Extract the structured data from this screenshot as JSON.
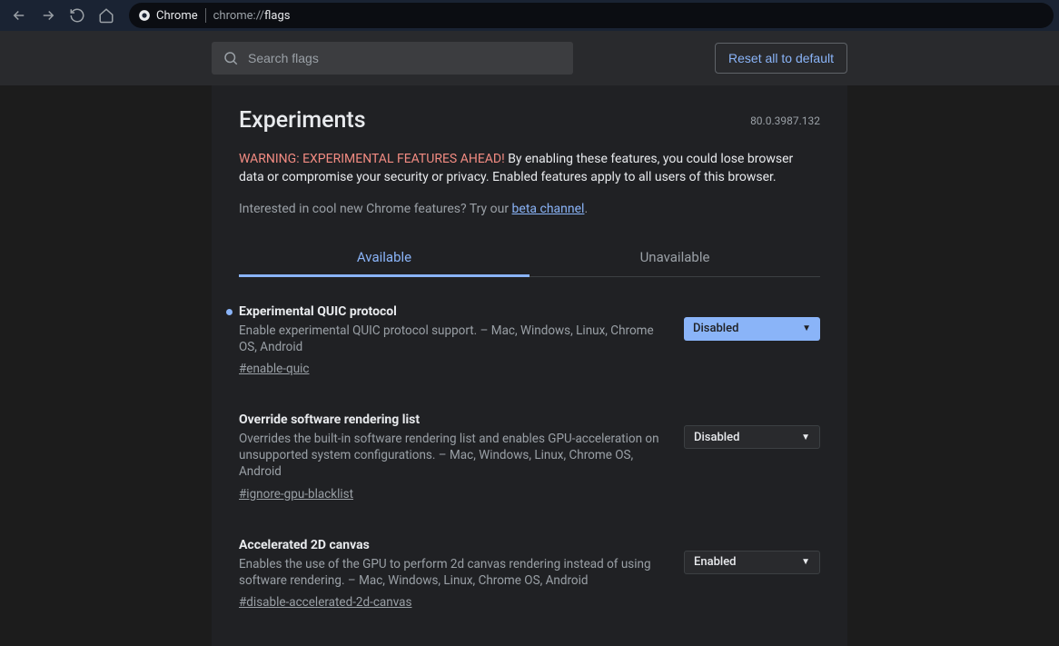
{
  "browser": {
    "name": "Chrome",
    "url_prefix": "chrome://",
    "url_path": "flags"
  },
  "header": {
    "search_placeholder": "Search flags",
    "reset_label": "Reset all to default"
  },
  "page": {
    "title": "Experiments",
    "version": "80.0.3987.132",
    "warning_prefix": "WARNING: EXPERIMENTAL FEATURES AHEAD!",
    "warning_body": " By enabling these features, you could lose browser data or compromise your security or privacy. Enabled features apply to all users of this browser.",
    "interested_text": "Interested in cool new Chrome features? Try our ",
    "interested_link": "beta channel",
    "interested_suffix": "."
  },
  "tabs": {
    "available": "Available",
    "unavailable": "Unavailable"
  },
  "flags": [
    {
      "title": "Experimental QUIC protocol",
      "desc": "Enable experimental QUIC protocol support. – Mac, Windows, Linux, Chrome OS, Android",
      "hash": "#enable-quic",
      "state": "Disabled",
      "highlight": true,
      "dot": true
    },
    {
      "title": "Override software rendering list",
      "desc": "Overrides the built-in software rendering list and enables GPU-acceleration on unsupported system configurations. – Mac, Windows, Linux, Chrome OS, Android",
      "hash": "#ignore-gpu-blacklist",
      "state": "Disabled",
      "highlight": false,
      "dot": false
    },
    {
      "title": "Accelerated 2D canvas",
      "desc": "Enables the use of the GPU to perform 2d canvas rendering instead of using software rendering. – Mac, Windows, Linux, Chrome OS, Android",
      "hash": "#disable-accelerated-2d-canvas",
      "state": "Enabled",
      "highlight": false,
      "dot": false
    }
  ]
}
